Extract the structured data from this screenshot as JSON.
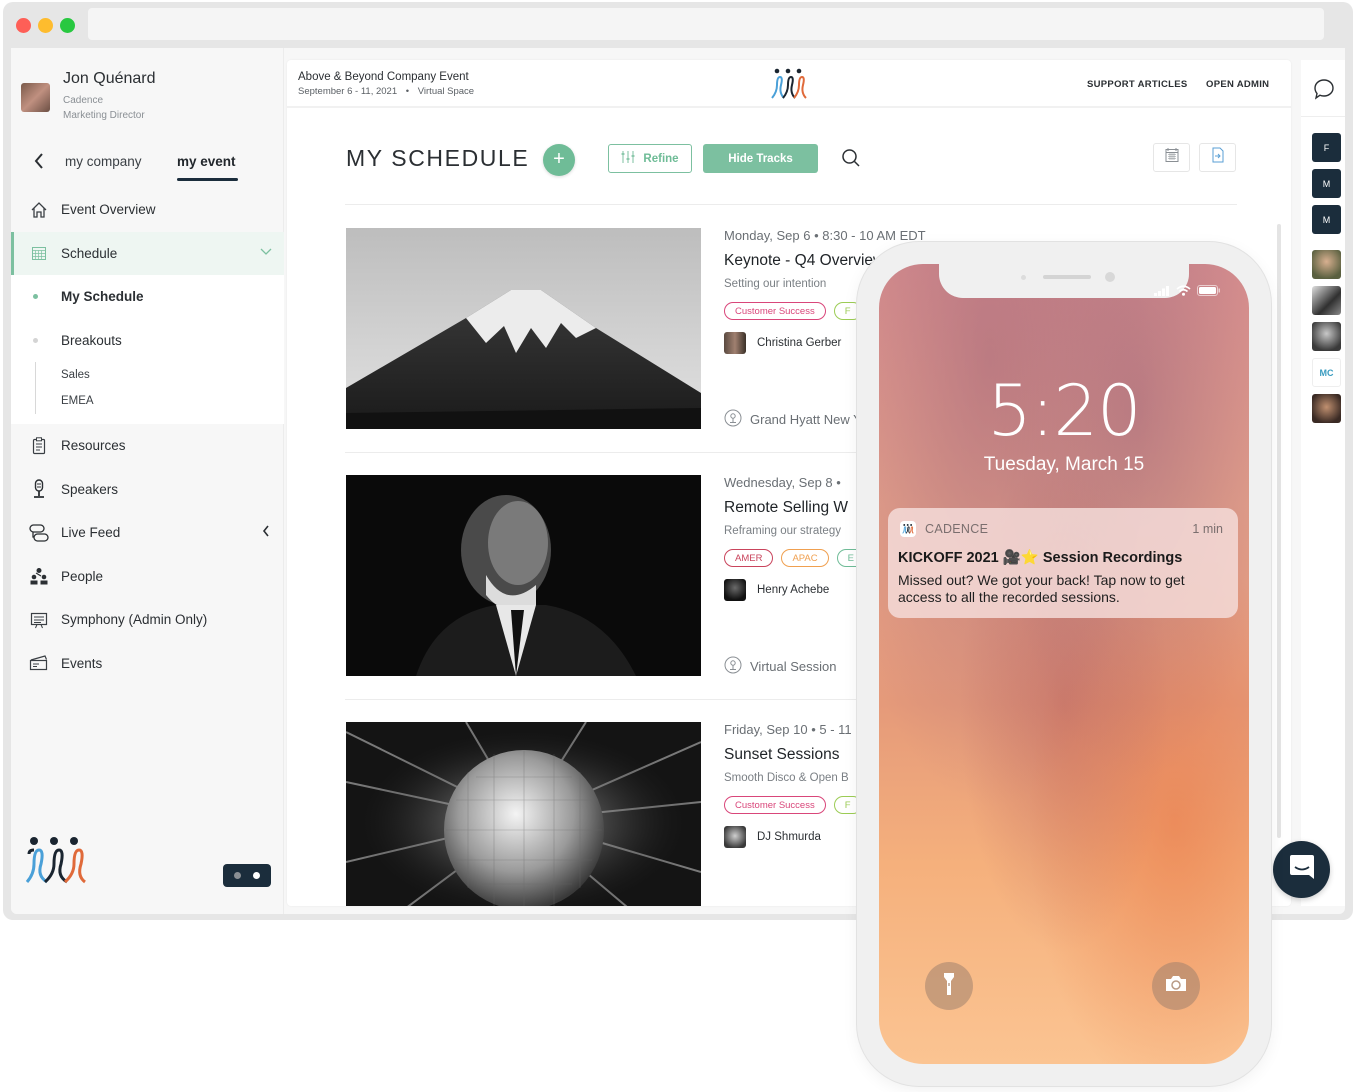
{
  "profile": {
    "name": "Jon Quénard",
    "company": "Cadence",
    "role": "Marketing Director"
  },
  "nav_tabs": {
    "company": "my company",
    "event": "my event"
  },
  "sidebar": {
    "items": [
      {
        "label": "Event Overview",
        "icon": "home-icon"
      },
      {
        "label": "Schedule",
        "icon": "calendar-icon"
      },
      {
        "label": "Resources",
        "icon": "document-icon"
      },
      {
        "label": "Speakers",
        "icon": "microphone-icon"
      },
      {
        "label": "Live Feed",
        "icon": "feed-icon"
      },
      {
        "label": "People",
        "icon": "people-icon"
      },
      {
        "label": "Symphony (Admin Only)",
        "icon": "presentation-icon"
      },
      {
        "label": "Events",
        "icon": "ticket-icon"
      }
    ],
    "schedule_sub": [
      {
        "label": "My Schedule"
      },
      {
        "label": "Breakouts"
      }
    ],
    "breakouts_sub": [
      {
        "label": "Sales"
      },
      {
        "label": "EMEA"
      }
    ]
  },
  "topbar": {
    "event_title": "Above & Beyond Company Event",
    "event_dates": "September 6 - 11, 2021",
    "event_location": "Virtual Space",
    "support_link": "SUPPORT ARTICLES",
    "admin_link": "OPEN ADMIN"
  },
  "schedule": {
    "title": "MY SCHEDULE",
    "add_label": "+",
    "refine_label": "Refine",
    "hide_tracks_label": "Hide Tracks",
    "sessions": [
      {
        "date": "Monday, Sep 6 • 8:30 - 10 AM EDT",
        "title": "Keynote - Q4 Overview",
        "subtitle": "Setting our intention",
        "tags": [
          {
            "label": "Customer Success",
            "color": "#d9467a"
          },
          {
            "label": "F",
            "color": "#9ccc55"
          }
        ],
        "speaker": "Christina Gerber",
        "location": "Grand Hyatt New York",
        "image": "mountain"
      },
      {
        "date": "Wednesday, Sep 8 •",
        "title": "Remote Selling W",
        "subtitle": "Reframing our strategy",
        "tags": [
          {
            "label": "AMER",
            "color": "#c9445c"
          },
          {
            "label": "APAC",
            "color": "#f0a050"
          },
          {
            "label": "E",
            "color": "#6fbc97"
          }
        ],
        "speaker": "Henry Achebe",
        "location": "Virtual Session",
        "image": "portrait"
      },
      {
        "date": "Friday, Sep 10 • 5 - 11",
        "title": "Sunset Sessions",
        "subtitle": "Smooth Disco & Open B",
        "tags": [
          {
            "label": "Customer Success",
            "color": "#d9467a"
          },
          {
            "label": "F",
            "color": "#9ccc55"
          }
        ],
        "speaker": "DJ Shmurda",
        "location": "",
        "image": "disco-ball"
      }
    ]
  },
  "rail": {
    "letters": [
      "F",
      "M",
      "M"
    ],
    "mc_label": "MC"
  },
  "phone": {
    "time": "5:20",
    "date": "Tuesday, March 15",
    "notification": {
      "app": "CADENCE",
      "time": "1 min",
      "title": "KICKOFF 2021 🎥⭐ Session Recordings",
      "body": "Missed out? We got your back! Tap now to get access to all the recorded sessions."
    }
  },
  "colors": {
    "accent": "#7cc0a0",
    "navy": "#1b2d3c",
    "tag_pink": "#d9467a",
    "tag_orange": "#f0a050"
  }
}
